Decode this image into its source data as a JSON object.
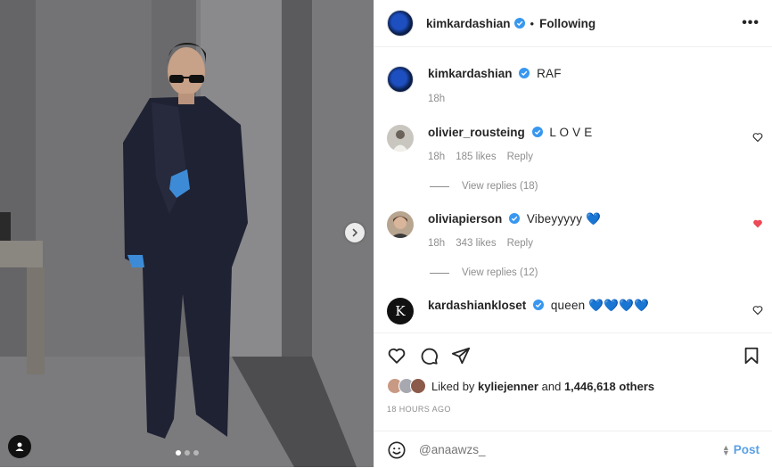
{
  "header": {
    "username": "kimkardashian",
    "separator": "•",
    "follow_status": "Following",
    "more_icon": "more-horizontal-icon"
  },
  "caption": {
    "username": "kimkardashian",
    "text": "RAF",
    "time": "18h"
  },
  "comments": [
    {
      "username": "olivier_rousteing",
      "text": "L O V E",
      "time": "18h",
      "likes": "185 likes",
      "reply_label": "Reply",
      "view_replies": "View replies (18)",
      "liked": false
    },
    {
      "username": "oliviapierson",
      "text": "Vibeyyyyy 💙",
      "time": "18h",
      "likes": "343 likes",
      "reply_label": "Reply",
      "view_replies": "View replies (12)",
      "liked": true
    },
    {
      "username": "kardashiankloset",
      "text": "queen 💙💙💙💙",
      "avatar_letter": "K",
      "liked": false
    }
  ],
  "likes_summary": {
    "prefix": "Liked by",
    "user": "kyliejenner",
    "conjunction": "and",
    "others": "1,446,618 others"
  },
  "timestamp": "18 HOURS AGO",
  "comment_box": {
    "placeholder": "@anaawzs_",
    "post_label": "Post",
    "emoji_icon": "smiley-icon"
  },
  "carousel": {
    "slide_count": 3,
    "active_slide": 1
  },
  "colors": {
    "verified": "#3897f0",
    "like_red": "#ed4956",
    "post_blue": "#5aa0e6",
    "muted": "#8e8e8e"
  }
}
